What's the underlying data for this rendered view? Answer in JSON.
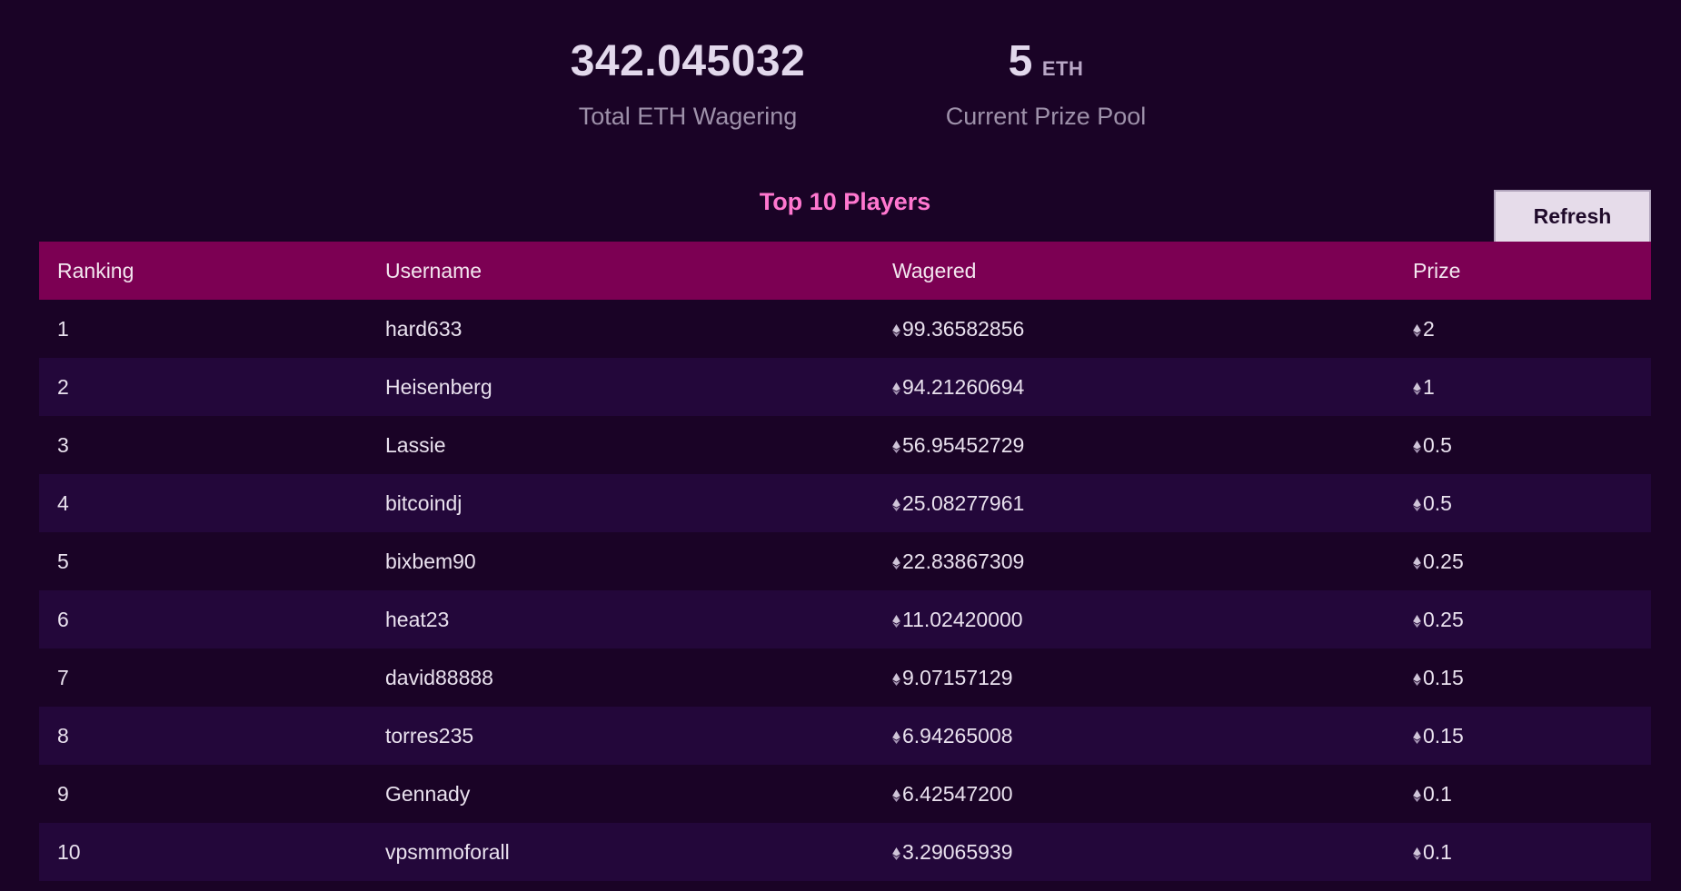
{
  "stats": {
    "total_wagering": {
      "value": "342.045032",
      "label": "Total ETH Wagering"
    },
    "prize_pool": {
      "value": "5",
      "unit": "ETH",
      "label": "Current Prize Pool"
    }
  },
  "leaderboard": {
    "title": "Top 10 Players",
    "refresh_label": "Refresh",
    "columns": [
      "Ranking",
      "Username",
      "Wagered",
      "Prize"
    ],
    "currency_icon": "ethereum-icon",
    "rows": [
      {
        "rank": "1",
        "username": "hard633",
        "wagered": "99.36582856",
        "prize": "2"
      },
      {
        "rank": "2",
        "username": "Heisenberg",
        "wagered": "94.21260694",
        "prize": "1"
      },
      {
        "rank": "3",
        "username": "Lassie",
        "wagered": "56.95452729",
        "prize": "0.5"
      },
      {
        "rank": "4",
        "username": "bitcoindj",
        "wagered": "25.08277961",
        "prize": "0.5"
      },
      {
        "rank": "5",
        "username": "bixbem90",
        "wagered": "22.83867309",
        "prize": "0.25"
      },
      {
        "rank": "6",
        "username": "heat23",
        "wagered": "11.02420000",
        "prize": "0.25"
      },
      {
        "rank": "7",
        "username": "david88888",
        "wagered": "9.07157129",
        "prize": "0.15"
      },
      {
        "rank": "8",
        "username": "torres235",
        "wagered": "6.94265008",
        "prize": "0.15"
      },
      {
        "rank": "9",
        "username": "Gennady",
        "wagered": "6.42547200",
        "prize": "0.1"
      },
      {
        "rank": "10",
        "username": "vpsmmoforall",
        "wagered": "3.29065939",
        "prize": "0.1"
      }
    ]
  },
  "colors": {
    "background": "#1a0326",
    "header_row": "#7c0053",
    "title_accent": "#ff77cf",
    "row_alt": "#23073a"
  }
}
